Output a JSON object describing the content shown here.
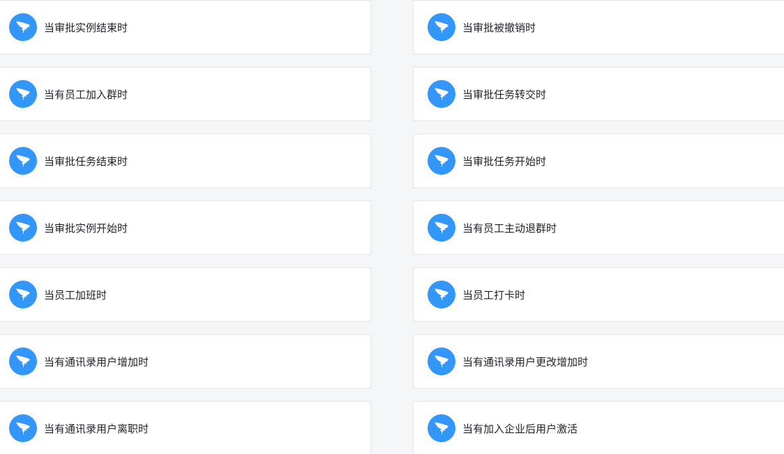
{
  "triggers": {
    "left": [
      {
        "label": "当审批实例结束时",
        "icon": "dingtalk-icon"
      },
      {
        "label": "当有员工加入群时",
        "icon": "dingtalk-icon"
      },
      {
        "label": "当审批任务结束时",
        "icon": "dingtalk-icon"
      },
      {
        "label": "当审批实例开始时",
        "icon": "dingtalk-icon"
      },
      {
        "label": "当员工加班时",
        "icon": "dingtalk-icon"
      },
      {
        "label": "当有通讯录用户增加时",
        "icon": "dingtalk-icon"
      },
      {
        "label": "当有通讯录用户离职时",
        "icon": "dingtalk-icon"
      }
    ],
    "right": [
      {
        "label": "当审批被撤销时",
        "icon": "dingtalk-icon"
      },
      {
        "label": "当审批任务转交时",
        "icon": "dingtalk-icon"
      },
      {
        "label": "当审批任务开始时",
        "icon": "dingtalk-icon"
      },
      {
        "label": "当有员工主动退群时",
        "icon": "dingtalk-icon"
      },
      {
        "label": "当员工打卡时",
        "icon": "dingtalk-icon"
      },
      {
        "label": "当有通讯录用户更改增加时",
        "icon": "dingtalk-icon"
      },
      {
        "label": "当有加入企业后用户激活",
        "icon": "dingtalk-icon"
      }
    ]
  },
  "colors": {
    "icon_bg": "#3296fa",
    "page_bg": "#f5f6f8",
    "card_bg": "#ffffff"
  }
}
